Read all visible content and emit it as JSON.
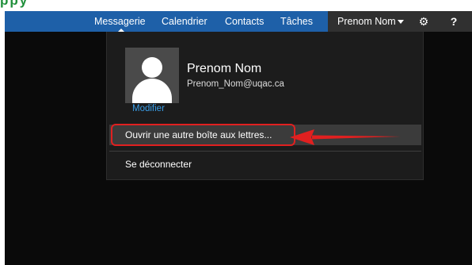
{
  "brand_fragment": "ppy",
  "nav": {
    "items": [
      {
        "label": "Messagerie"
      },
      {
        "label": "Calendrier"
      },
      {
        "label": "Contacts"
      },
      {
        "label": "Tâches"
      }
    ],
    "user_label": "Prenom Nom",
    "settings_icon": "gear-icon",
    "help_label": "?"
  },
  "profile": {
    "name": "Prenom Nom",
    "email": "Prenom_Nom@uqac.ca",
    "modify_label": "Modifier",
    "avatar_icon": "user-silhouette-icon"
  },
  "menu": {
    "open_mailbox_label": "Ouvrir une autre boîte aux lettres...",
    "logout_label": "Se déconnecter"
  },
  "colors": {
    "navbar": "#1e60a8",
    "background": "#0a0a0a",
    "panel": "#1c1c1c",
    "highlight": "#e02020",
    "link": "#3a9ee8"
  }
}
